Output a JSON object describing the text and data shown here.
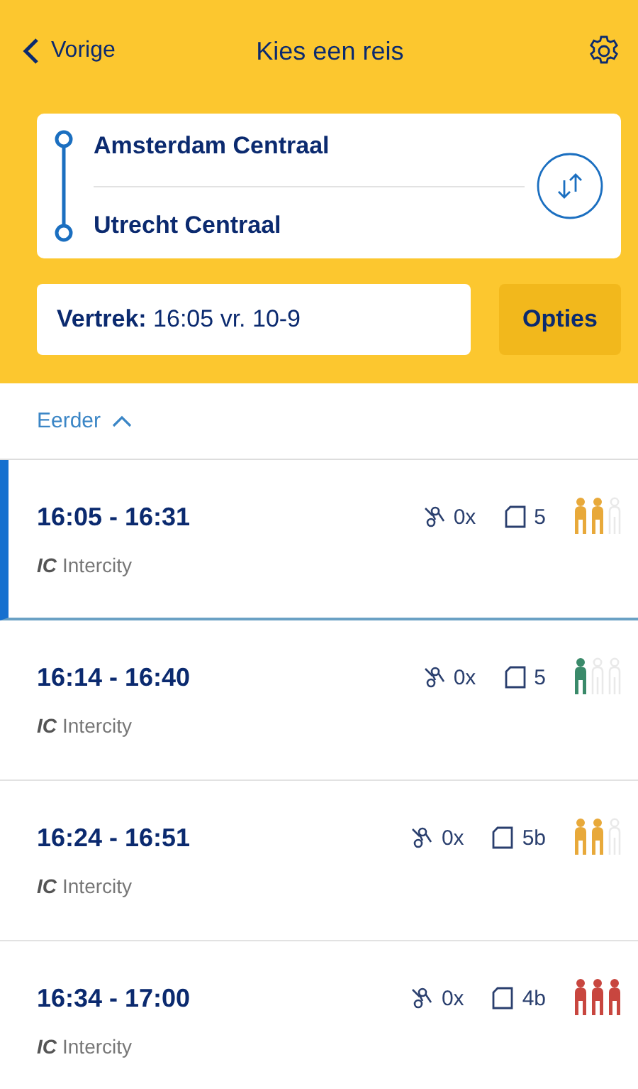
{
  "nav": {
    "back": "Vorige",
    "title": "Kies een reis"
  },
  "route": {
    "from": "Amsterdam Centraal",
    "to": "Utrecht Centraal"
  },
  "departure": {
    "label": "Vertrek:",
    "value": "16:05 vr. 10-9"
  },
  "options_button": "Opties",
  "earlier": "Eerder",
  "trips": [
    {
      "times": "16:05 - 16:31",
      "transfers": "0x",
      "platform": "5",
      "type_code": "IC",
      "type": "Intercity",
      "color": "#e8a93a",
      "occupancy": [
        {
          "filled": true
        },
        {
          "filled": true
        },
        {
          "filled": false
        }
      ],
      "selected": true
    },
    {
      "times": "16:14 - 16:40",
      "transfers": "0x",
      "platform": "5",
      "type_code": "IC",
      "type": "Intercity",
      "color": "#3a8a6a",
      "occupancy": [
        {
          "filled": true
        },
        {
          "filled": false
        },
        {
          "filled": false
        }
      ],
      "selected": false
    },
    {
      "times": "16:24 - 16:51",
      "transfers": "0x",
      "platform": "5b",
      "type_code": "IC",
      "type": "Intercity",
      "color": "#e8a93a",
      "occupancy": [
        {
          "filled": true
        },
        {
          "filled": true
        },
        {
          "filled": false
        }
      ],
      "selected": false
    },
    {
      "times": "16:34 - 17:00",
      "transfers": "0x",
      "platform": "4b",
      "type_code": "IC",
      "type": "Intercity",
      "color": "#c8463f",
      "occupancy": [
        {
          "filled": true
        },
        {
          "filled": true
        },
        {
          "filled": true
        }
      ],
      "selected": false
    }
  ]
}
